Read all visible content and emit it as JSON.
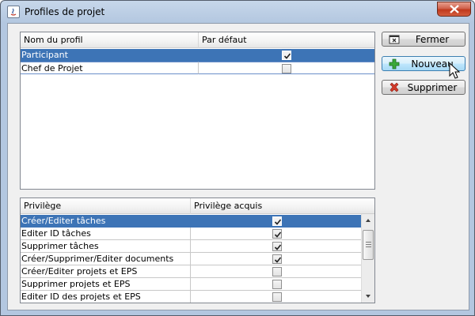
{
  "window": {
    "title": "Profiles de projet"
  },
  "profiles_table": {
    "columns": [
      "Nom du profil",
      "Par défaut"
    ],
    "rows": [
      {
        "name": "Participant",
        "default": true,
        "selected": true
      },
      {
        "name": "Chef de Projet",
        "default": false,
        "selected": false
      }
    ]
  },
  "privileges_table": {
    "columns": [
      "Privilège",
      "Privilège acquis"
    ],
    "rows": [
      {
        "name": "Créer/Editer tâches",
        "acquired": true,
        "selected": true
      },
      {
        "name": "Editer ID tâches",
        "acquired": true,
        "selected": false
      },
      {
        "name": "Supprimer tâches",
        "acquired": true,
        "selected": false
      },
      {
        "name": "Créer/Supprimer/Editer documents",
        "acquired": true,
        "selected": false
      },
      {
        "name": "Créer/Editer projets et EPS",
        "acquired": false,
        "selected": false
      },
      {
        "name": "Supprimer projets et EPS",
        "acquired": false,
        "selected": false
      },
      {
        "name": "Editer ID  des projets et EPS",
        "acquired": false,
        "selected": false
      }
    ]
  },
  "buttons": {
    "close": "Fermer",
    "new": "Nouveau",
    "delete": "Supprimer"
  },
  "colors": {
    "selection": "#3d74b6",
    "add_icon": "#2e9a2e",
    "delete_icon": "#c0392b"
  }
}
